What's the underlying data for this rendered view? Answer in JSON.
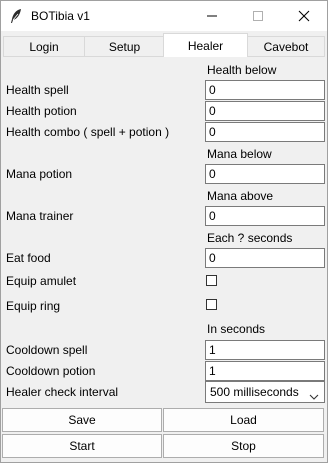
{
  "window": {
    "title": "BOTibia v1"
  },
  "tabs": [
    {
      "label": "Login"
    },
    {
      "label": "Setup"
    },
    {
      "label": "Healer",
      "active": true
    },
    {
      "label": "Cavebot"
    }
  ],
  "healer": {
    "health_below_header": "Health below",
    "health_spell": {
      "label": "Health spell",
      "value": "0"
    },
    "health_potion": {
      "label": "Health potion",
      "value": "0"
    },
    "health_combo": {
      "label": "Health combo ( spell + potion )",
      "value": "0"
    },
    "mana_below_header": "Mana below",
    "mana_potion": {
      "label": "Mana potion",
      "value": "0"
    },
    "mana_above_header": "Mana above",
    "mana_trainer": {
      "label": "Mana trainer",
      "value": "0"
    },
    "each_seconds_header": "Each ? seconds",
    "eat_food": {
      "label": "Eat food",
      "value": "0"
    },
    "equip_amulet": {
      "label": "Equip amulet",
      "checked": false
    },
    "equip_ring": {
      "label": "Equip ring",
      "checked": false
    },
    "in_seconds_header": "In seconds",
    "cooldown_spell": {
      "label": "Cooldown spell",
      "value": "1"
    },
    "cooldown_potion": {
      "label": "Cooldown potion",
      "value": "1"
    },
    "check_interval": {
      "label": "Healer check interval",
      "value": "500 milliseconds"
    }
  },
  "buttons": {
    "save": "Save",
    "load": "Load",
    "start": "Start",
    "stop": "Stop"
  }
}
